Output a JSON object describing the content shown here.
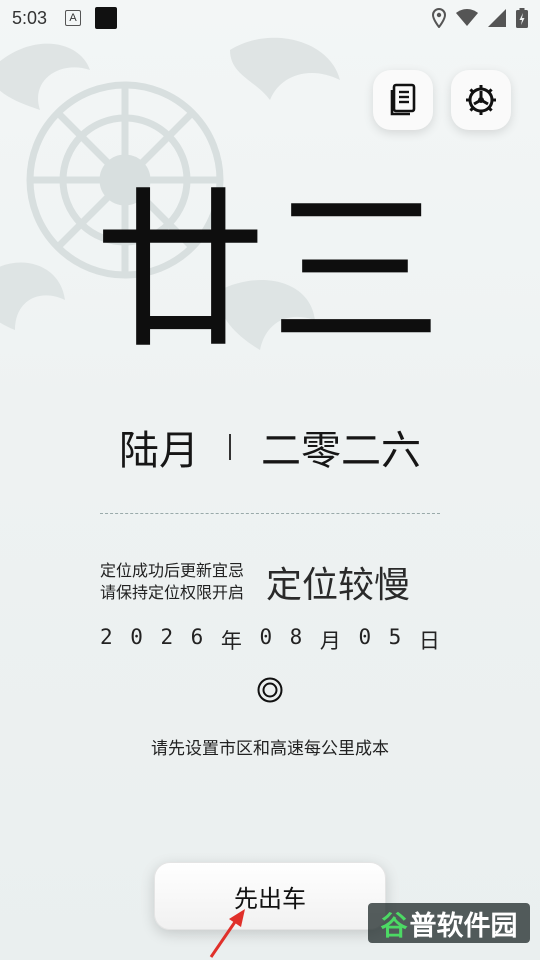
{
  "status_bar": {
    "time": "5:03",
    "notification_letter": "A"
  },
  "icons": {
    "notes": "notes-icon",
    "settings": "settings-gear-icon",
    "locate": "target-icon"
  },
  "lunar": {
    "day": "廿三",
    "month": "陆月",
    "year": "二零二六"
  },
  "location": {
    "hint_line1": "定位成功后更新宜忌",
    "hint_line2": "请保持定位权限开启",
    "status": "定位较慢"
  },
  "date": [
    "2",
    "0",
    "2",
    "6",
    "年",
    "0",
    "8",
    "月",
    "0",
    "5",
    "日"
  ],
  "cost_hint": "请先设置市区和高速每公里成本",
  "depart_button_label": "先出车",
  "watermark": {
    "first": "谷",
    "rest": "普软件园"
  },
  "colors": {
    "background": "#eef2f2",
    "text": "#111111",
    "arrow": "#e0302a"
  }
}
